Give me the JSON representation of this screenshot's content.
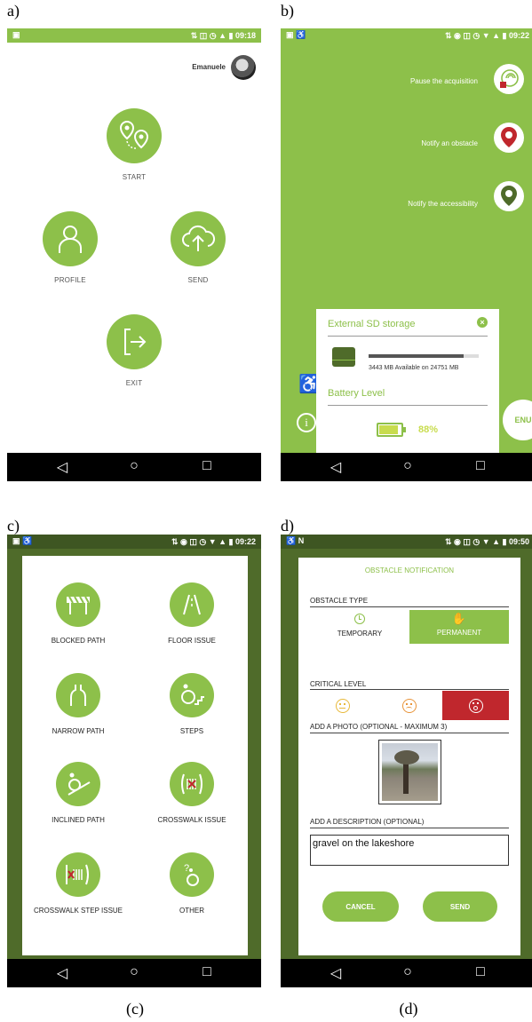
{
  "panel_tags": [
    "a)",
    "b)",
    "c)",
    "d)"
  ],
  "captions": [
    "(c)",
    "(d)"
  ],
  "colors": {
    "accent": "#8dc04a",
    "dark_overlay": "#4f6b2a",
    "critical": "#c0272d"
  },
  "status": {
    "a_time": "09:18",
    "b_time": "09:22",
    "c_time": "09:22",
    "d_time": "09:50"
  },
  "screen_a": {
    "user_name": "Emanuele",
    "buttons": [
      {
        "label": "START",
        "icon": "route-icon"
      },
      {
        "label": "PROFILE",
        "icon": "person-icon"
      },
      {
        "label": "SEND",
        "icon": "cloud-upload-icon"
      },
      {
        "label": "EXIT",
        "icon": "exit-icon"
      }
    ]
  },
  "screen_b": {
    "actions": [
      {
        "label": "Pause the acquisition",
        "icon": "pause-acquisition-icon"
      },
      {
        "label": "Notify an obstacle",
        "icon": "obstacle-pin-icon"
      },
      {
        "label": "Notify the accessibility",
        "icon": "accessibility-pin-icon"
      }
    ],
    "storage_title": "External SD storage",
    "storage_text": "3443 MB Available on 24751 MB",
    "storage_used_fraction": 0.86,
    "battery_title": "Battery Level",
    "battery_value": "88%",
    "battery_fraction": 0.88,
    "menu_label": "ENU"
  },
  "screen_c": {
    "items": [
      {
        "label": "BLOCKED PATH",
        "icon": "barrier-icon"
      },
      {
        "label": "FLOOR ISSUE",
        "icon": "floor-icon"
      },
      {
        "label": "NARROW PATH",
        "icon": "narrow-path-icon"
      },
      {
        "label": "STEPS",
        "icon": "steps-icon"
      },
      {
        "label": "INCLINED PATH",
        "icon": "incline-icon"
      },
      {
        "label": "CROSSWALK ISSUE",
        "icon": "crosswalk-icon"
      },
      {
        "label": "CROSSWALK STEP ISSUE",
        "icon": "crosswalk-step-icon"
      },
      {
        "label": "OTHER",
        "icon": "question-wheelchair-icon"
      }
    ]
  },
  "screen_d": {
    "title": "OBSTACLE NOTIFICATION",
    "type_label": "OBSTACLE TYPE",
    "type_temporary": "TEMPORARY",
    "type_permanent": "PERMANENT",
    "critical_label": "CRITICAL LEVEL",
    "photo_label": "ADD A PHOTO (OPTIONAL - MAXIMUM 3)",
    "description_label": "ADD A DESCRIPTION (OPTIONAL)",
    "description_value": "gravel on the lakeshore",
    "cancel": "CANCEL",
    "send": "SEND"
  }
}
